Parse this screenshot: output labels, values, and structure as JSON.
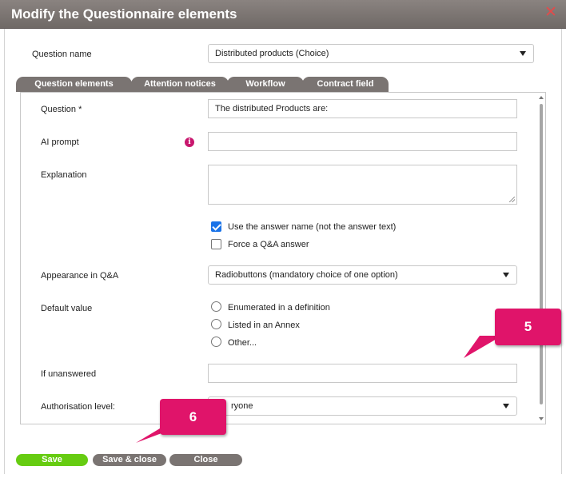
{
  "dialog": {
    "title": "Modify the Questionnaire elements",
    "close_symbol": "✕"
  },
  "question_name": {
    "label": "Question name",
    "value": "Distributed products (Choice)"
  },
  "tabs": [
    {
      "label": "Question elements",
      "active": true
    },
    {
      "label": "Attention notices",
      "active": false
    },
    {
      "label": "Workflow",
      "active": false
    },
    {
      "label": "Contract field",
      "active": false
    }
  ],
  "form": {
    "question_label": "Question *",
    "question_value": "The distributed Products are:",
    "ai_prompt_label": "AI prompt",
    "ai_prompt_value": "",
    "info_icon_glyph": "i",
    "explanation_label": "Explanation",
    "explanation_value": "",
    "use_answer_name_label": "Use the answer name (not the answer text)",
    "use_answer_name_checked": true,
    "force_qa_label": "Force a Q&A answer",
    "force_qa_checked": false,
    "appearance_label": "Appearance in Q&A",
    "appearance_value": "Radiobuttons (mandatory choice of one option)",
    "default_value_label": "Default value",
    "default_options": [
      "Enumerated in a definition",
      "Listed in an Annex",
      "Other..."
    ],
    "if_unanswered_label": "If unanswered",
    "if_unanswered_value": "",
    "authorisation_label": "Authorisation level:",
    "authorisation_value": "ryone"
  },
  "buttons": {
    "save": "Save",
    "save_close": "Save & close",
    "close": "Close"
  },
  "callouts": {
    "five": "5",
    "six": "6"
  },
  "colors": {
    "accent_pink": "#e0146a",
    "save_green": "#66cc11",
    "tab_gray": "#7a7472",
    "checkbox_blue": "#1a73e8"
  }
}
